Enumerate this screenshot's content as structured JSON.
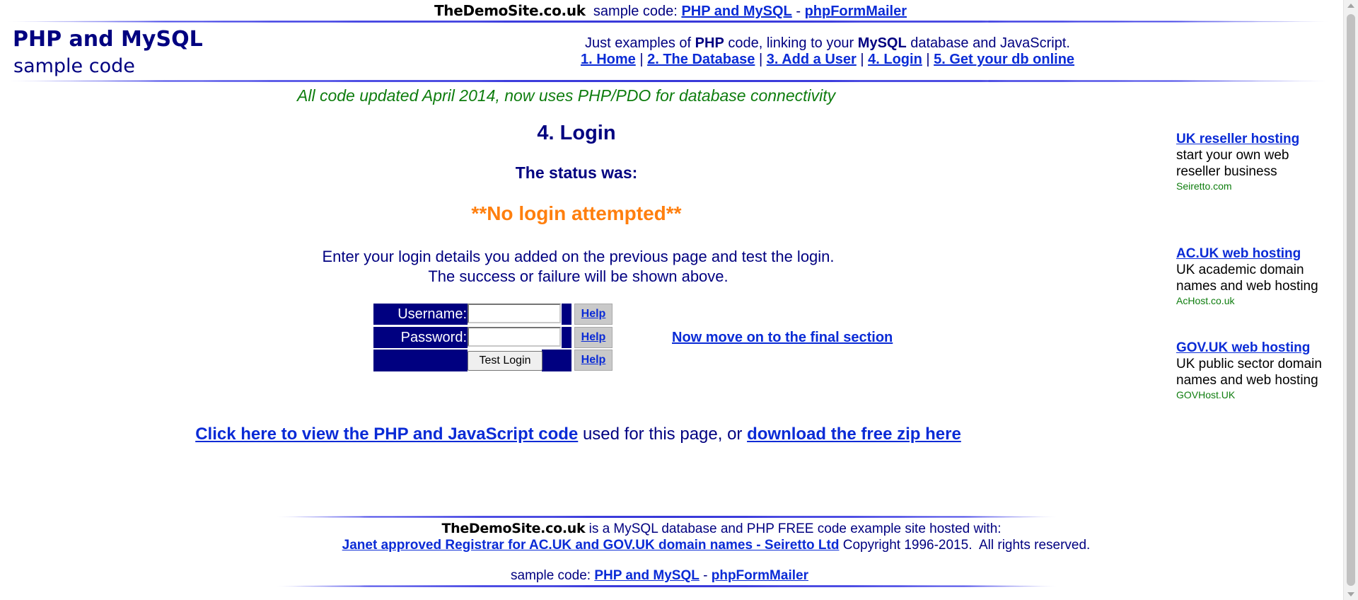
{
  "topbar": {
    "brand": "TheDemoSite.co.uk",
    "prefix": "sample code:",
    "link1": "PHP and MySQL",
    "sep": "-",
    "link2": "phpFormMailer"
  },
  "header": {
    "logo_title": "PHP and MySQL",
    "logo_sub": "sample code",
    "tagline_pre": "Just examples of ",
    "tagline_php": "PHP",
    "tagline_mid": " code, linking to your ",
    "tagline_mysql": "MySQL",
    "tagline_post": " database and JavaScript.",
    "nav": [
      {
        "label": "1. Home"
      },
      {
        "label": "2. The Database"
      },
      {
        "label": "3. Add a User"
      },
      {
        "label": "4. Login"
      },
      {
        "label": "5. Get your db online"
      }
    ],
    "nav_sep": "|"
  },
  "updated_note": "All code updated April 2014, now uses PHP/PDO for database connectivity",
  "main": {
    "title": "4. Login",
    "status_label": "The status was:",
    "status_value": "**No login attempted**",
    "instructions_line1": "Enter your login details you added on the previous page and test the login.",
    "instructions_line2": "The success or failure will be shown above.",
    "form": {
      "username_label": "Username:",
      "username_value": "",
      "password_label": "Password:",
      "password_value": "",
      "submit_label": "Test Login",
      "help_label": "Help"
    },
    "move_on_link": "Now move on to the final section",
    "code_link": "Click here to view the PHP and JavaScript code",
    "code_mid": " used for this page, or ",
    "zip_link": "download the free zip here"
  },
  "sidebar": {
    "ads": [
      {
        "title": "UK reseller hosting",
        "text": "start your own web reseller business",
        "host": "Seiretto.com"
      },
      {
        "title": "AC.UK web hosting",
        "text": "UK academic domain names and web hosting",
        "host": "AcHost.co.uk"
      },
      {
        "title": "GOV.UK web hosting",
        "text": "UK public sector domain names and web hosting",
        "host": "GOVHost.UK"
      }
    ]
  },
  "footer": {
    "brand": "TheDemoSite.co.uk",
    "line1_text": " is a MySQL database and PHP FREE code example site hosted with:",
    "registrar_link": "Janet approved Registrar for AC.UK and GOV.UK domain names - Seiretto Ltd",
    "copyright": " Copyright 1996-2015.  All rights reserved.",
    "sample_prefix": "sample code: ",
    "link1": "PHP and MySQL",
    "sep": " - ",
    "link2": "phpFormMailer"
  }
}
